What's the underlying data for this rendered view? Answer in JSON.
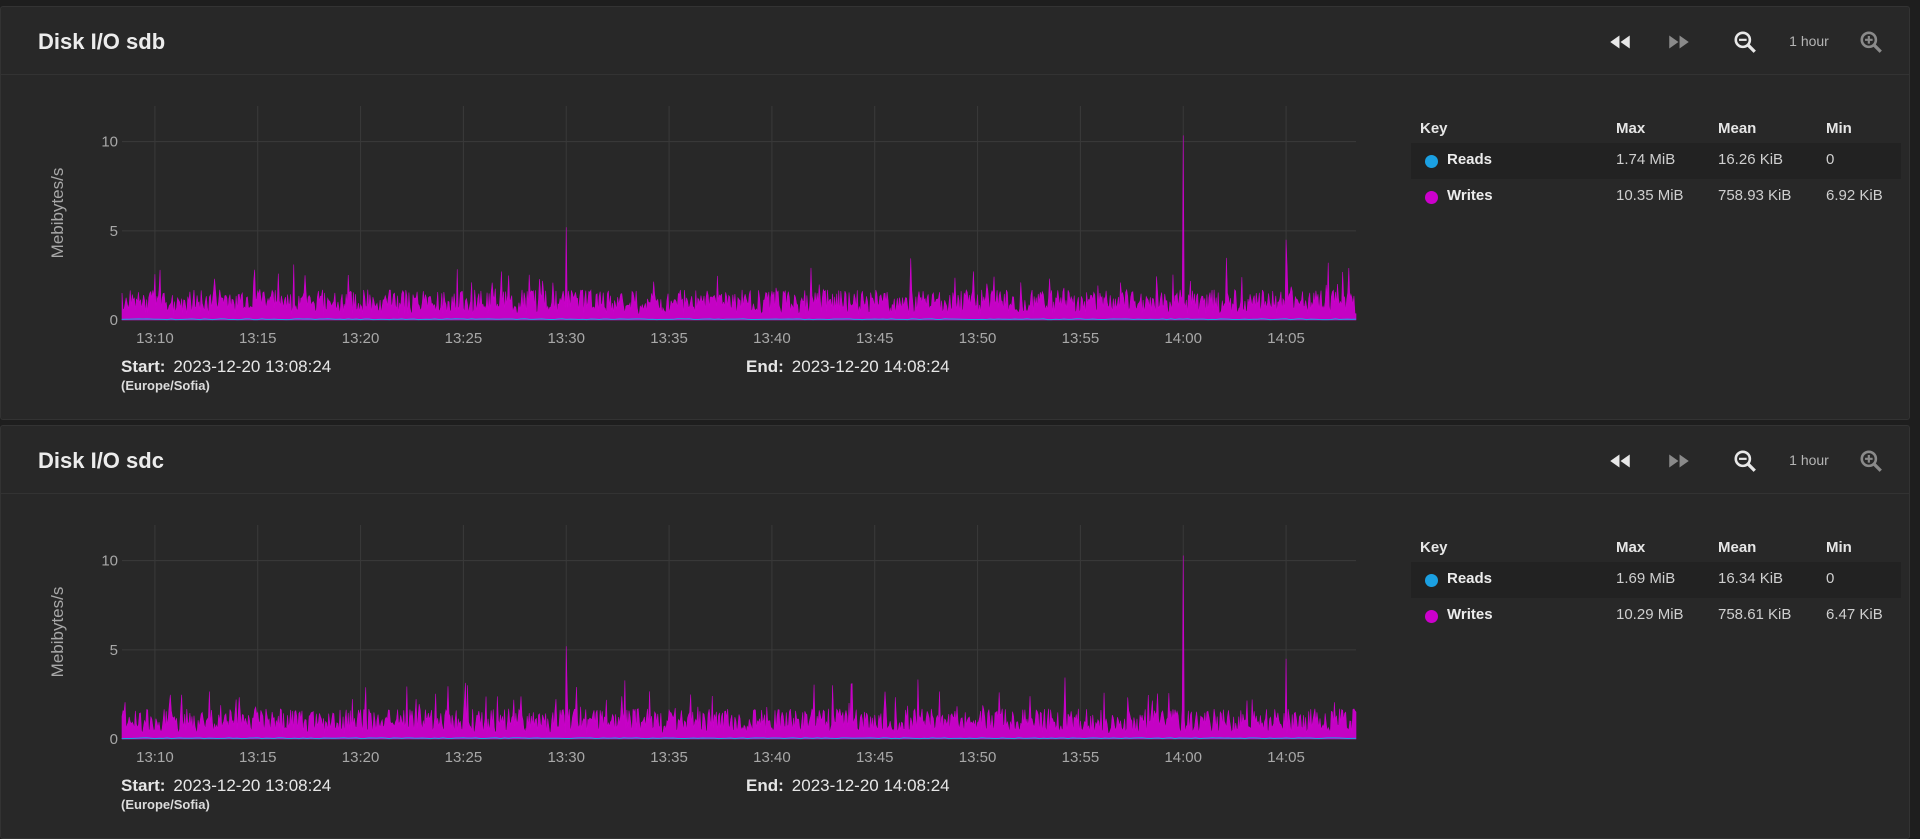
{
  "colors": {
    "reads": "#1ba0e2",
    "writes": "#cc00cc",
    "panel_bg": "#282828",
    "grid": "#3a3a3a"
  },
  "icons": {
    "back": "rewind-icon",
    "forward": "fast-forward-icon",
    "zoom_out": "zoom-out-icon",
    "zoom_in": "zoom-in-icon"
  },
  "panels": [
    {
      "title": "Disk I/O sdb",
      "zoom_label": "1 hour",
      "ylabel": "Mebibytes/s",
      "start_label": "Start:",
      "start_value": "2023-12-20 13:08:24",
      "timezone": "(Europe/Sofia)",
      "end_label": "End:",
      "end_value": "2023-12-20 14:08:24",
      "legend": {
        "headers": {
          "key": "Key",
          "max": "Max",
          "mean": "Mean",
          "min": "Min"
        },
        "rows": [
          {
            "key": "Reads",
            "max": "1.74 MiB",
            "mean": "16.26 KiB",
            "min": "0"
          },
          {
            "key": "Writes",
            "max": "10.35 MiB",
            "mean": "758.93 KiB",
            "min": "6.92 KiB"
          }
        ]
      }
    },
    {
      "title": "Disk I/O sdc",
      "zoom_label": "1 hour",
      "ylabel": "Mebibytes/s",
      "start_label": "Start:",
      "start_value": "2023-12-20 13:08:24",
      "timezone": "(Europe/Sofia)",
      "end_label": "End:",
      "end_value": "2023-12-20 14:08:24",
      "legend": {
        "headers": {
          "key": "Key",
          "max": "Max",
          "mean": "Mean",
          "min": "Min"
        },
        "rows": [
          {
            "key": "Reads",
            "max": "1.69 MiB",
            "mean": "16.34 KiB",
            "min": "0"
          },
          {
            "key": "Writes",
            "max": "10.29 MiB",
            "mean": "758.61 KiB",
            "min": "6.47 KiB"
          }
        ]
      }
    }
  ],
  "chart_data": [
    {
      "type": "area",
      "ylabel": "Mebibytes/s",
      "ylim": [
        0,
        12
      ],
      "yticks": [
        0,
        5,
        10
      ],
      "xlim": [
        "13:08:24",
        "14:08:24"
      ],
      "xticks": [
        "13:10",
        "13:15",
        "13:20",
        "13:25",
        "13:30",
        "13:35",
        "13:40",
        "13:45",
        "13:50",
        "13:55",
        "14:00",
        "14:05"
      ],
      "grid": true,
      "series": [
        {
          "name": "Reads",
          "typical": 0.02,
          "max": 1.74
        },
        {
          "name": "Writes",
          "typical": 0.74,
          "max": 10.35,
          "peaks": [
            [
              "13:30",
              5.2
            ],
            [
              "14:00",
              10.35
            ],
            [
              "14:05",
              4.5
            ]
          ]
        }
      ]
    },
    {
      "type": "area",
      "ylabel": "Mebibytes/s",
      "ylim": [
        0,
        12
      ],
      "yticks": [
        0,
        5,
        10
      ],
      "xlim": [
        "13:08:24",
        "14:08:24"
      ],
      "xticks": [
        "13:10",
        "13:15",
        "13:20",
        "13:25",
        "13:30",
        "13:35",
        "13:40",
        "13:45",
        "13:50",
        "13:55",
        "14:00",
        "14:05"
      ],
      "grid": true,
      "series": [
        {
          "name": "Reads",
          "typical": 0.02,
          "max": 1.69
        },
        {
          "name": "Writes",
          "typical": 0.74,
          "max": 10.29,
          "peaks": [
            [
              "13:30",
              5.2
            ],
            [
              "14:00",
              10.29
            ],
            [
              "14:05",
              4.5
            ]
          ]
        }
      ]
    }
  ]
}
